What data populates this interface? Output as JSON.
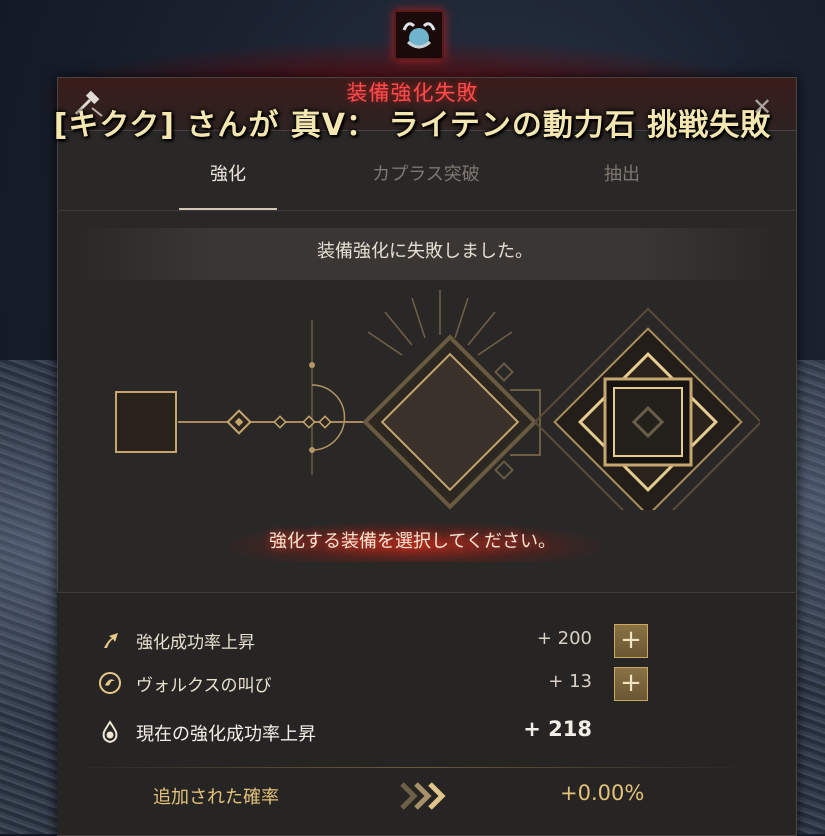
{
  "notice": {
    "fail_title": "装備強化失敗",
    "broadcast": "[キクク] さんが 真V： ライテンの動力石 挑戦失敗"
  },
  "tabs": [
    {
      "label": "強化",
      "active": true
    },
    {
      "label": "カプラス突破",
      "active": false
    },
    {
      "label": "抽出",
      "active": false
    }
  ],
  "message": "装備強化に失敗しました。",
  "prompt": "強化する装備を選択してください。",
  "stats": [
    {
      "label": "強化成功率上昇",
      "value": "+ 200",
      "icon": "arrow-up-icon"
    },
    {
      "label": "ヴォルクスの叫び",
      "value": "+ 13",
      "icon": "valks-cry-icon"
    }
  ],
  "current": {
    "label": "現在の強化成功率上昇",
    "value": "+ 218",
    "icon": "flame-icon"
  },
  "added": {
    "label": "追加された確率",
    "value": "+0.00%"
  },
  "plus_symbol": "+",
  "close_symbol": "✕",
  "colors": {
    "accent_gold": "#e3c27a",
    "fail_red": "#ff4b4b",
    "panel_bg": "#2a2827"
  }
}
